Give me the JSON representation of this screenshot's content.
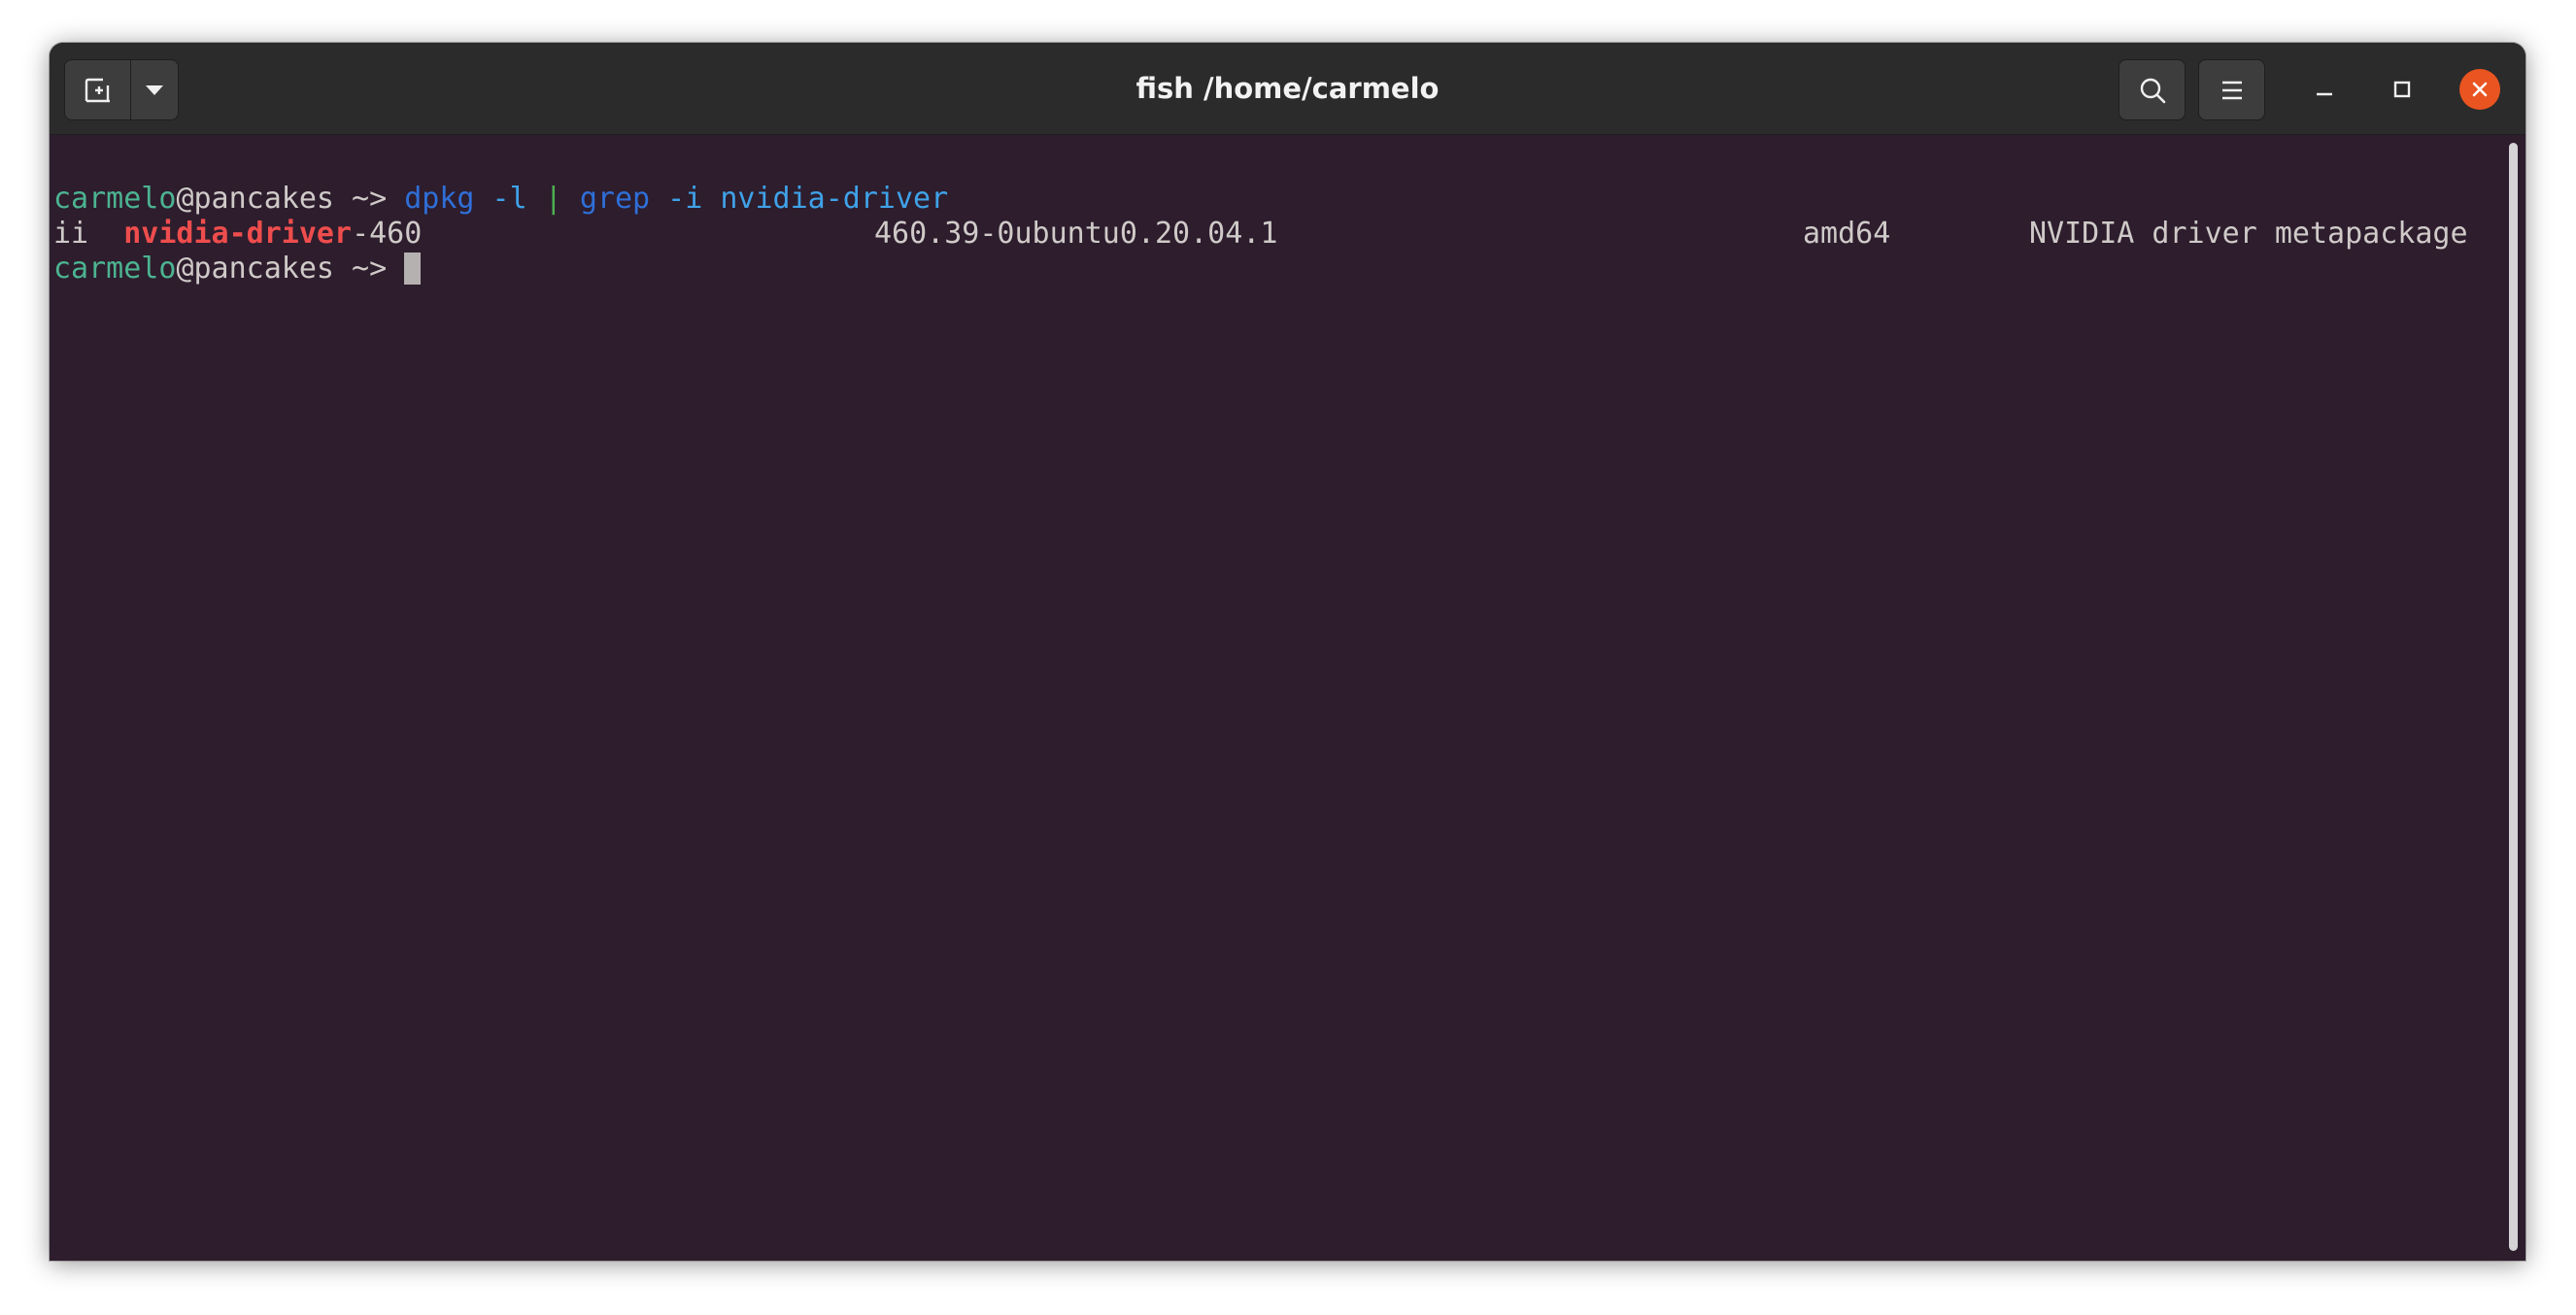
{
  "window": {
    "title": "fish /home/carmelo"
  },
  "icons": {
    "new_tab": "new-tab-icon",
    "new_tab_menu": "chevron-down-icon",
    "search": "search-icon",
    "menu": "hamburger-menu-icon",
    "minimize": "minimize-icon",
    "maximize": "maximize-icon",
    "close": "close-icon"
  },
  "colors": {
    "terminal_bg": "#2d1d2d",
    "titlebar_bg": "#2b2b2b",
    "close_button": "#e95420",
    "prompt_user": "#4cb391",
    "command": "#2f6fd8",
    "argument": "#3fa2e8",
    "match_highlight": "#ee4d4d"
  },
  "terminal": {
    "line1": {
      "user": "carmelo",
      "at": "@",
      "host": "pancakes",
      "prompt": " ~> ",
      "cmd1": "dpkg",
      "arg1": " -l ",
      "pipe": "|",
      "cmd2": " grep",
      "arg2": " -i nvidia-driver"
    },
    "line2": {
      "status": "ii  ",
      "match": "nvidia-driver",
      "rest": "-460",
      "version": "460.39-0ubuntu0.20.04.1",
      "arch": "amd64",
      "description": "NVIDIA driver metapackage"
    },
    "line3": {
      "user": "carmelo",
      "at": "@",
      "host": "pancakes",
      "prompt": " ~> "
    }
  }
}
